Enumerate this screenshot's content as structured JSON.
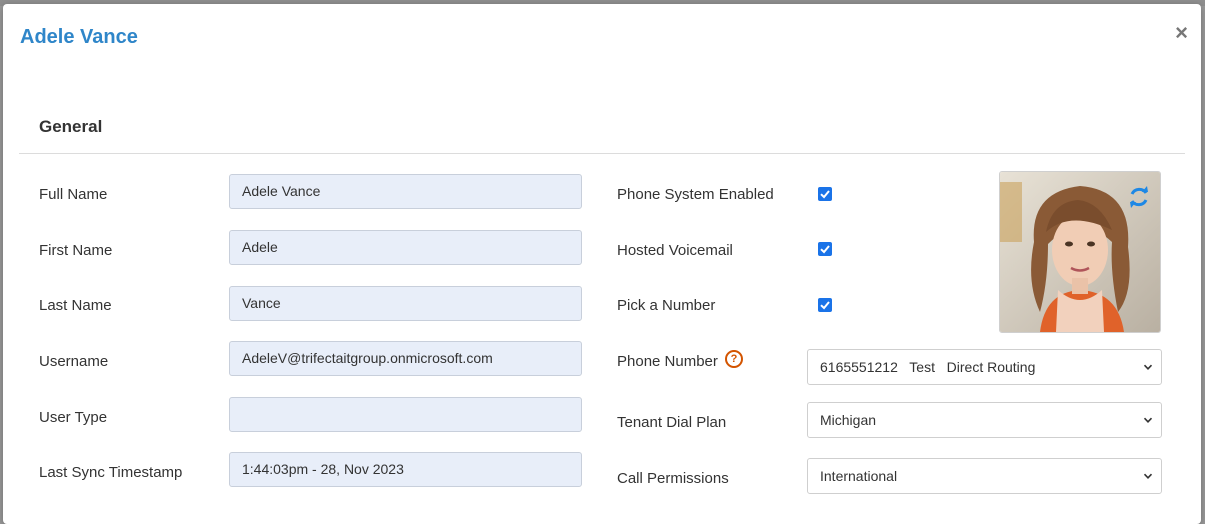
{
  "modal": {
    "title": "Adele Vance",
    "close_label": "×"
  },
  "section": {
    "title": "General"
  },
  "left_fields": [
    {
      "label": "Full Name",
      "value": "Adele Vance"
    },
    {
      "label": "First Name",
      "value": "Adele"
    },
    {
      "label": "Last Name",
      "value": "Vance"
    },
    {
      "label": "Username",
      "value": "AdeleV@trifectaitgroup.onmicrosoft.com"
    },
    {
      "label": "User Type",
      "value": ""
    },
    {
      "label": "Last Sync Timestamp",
      "value": "1:44:03pm - 28, Nov 2023"
    }
  ],
  "checkboxes": [
    {
      "label": "Phone System Enabled",
      "checked": true
    },
    {
      "label": "Hosted Voicemail",
      "checked": true
    },
    {
      "label": "Pick a Number",
      "checked": true
    }
  ],
  "phone_number": {
    "label": "Phone Number",
    "number": "6165551212",
    "tag": "Test",
    "routing": "Direct Routing"
  },
  "tenant_dial_plan": {
    "label": "Tenant Dial Plan",
    "value": "Michigan"
  },
  "call_permissions": {
    "label": "Call Permissions",
    "value": "International"
  },
  "colors": {
    "accent": "#2f86c9",
    "checkbox": "#1a73e8",
    "help": "#d35400",
    "input_bg": "#e8eef9"
  },
  "icons": [
    "close-icon",
    "help-icon",
    "refresh-icon",
    "chevron-down-icon",
    "check-icon"
  ]
}
